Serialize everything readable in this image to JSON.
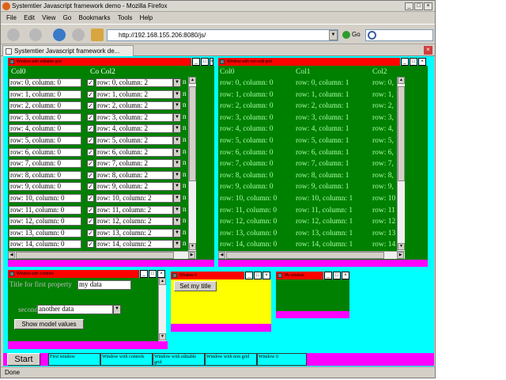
{
  "browser": {
    "title": "Systemtier Javascript framework demo - Mozilla Firefox",
    "menu": [
      "File",
      "Edit",
      "View",
      "Go",
      "Bookmarks",
      "Tools",
      "Help"
    ],
    "url": "http://192.168.155.206:8080/js/",
    "go_label": "Go",
    "tab_label": "Systemtier Javascript framework de...",
    "status": "Done"
  },
  "grid_window": {
    "title": "Window with editable grid",
    "headers": [
      "Col0",
      "Co Col2",
      ""
    ],
    "rows": [
      [
        "row: 0, column: 0",
        "row: 0, column: 2",
        "n"
      ],
      [
        "row: 1, column: 0",
        "row: 1, column: 2",
        "n"
      ],
      [
        "row: 2, column: 0",
        "row: 2, column: 2",
        "n"
      ],
      [
        "row: 3, column: 0",
        "row: 3, column: 2",
        "n"
      ],
      [
        "row: 4, column: 0",
        "row: 4, column: 2",
        "n"
      ],
      [
        "row: 5, column: 0",
        "row: 5, column: 2",
        "n"
      ],
      [
        "row: 6, column: 0",
        "row: 6, column: 2",
        "n"
      ],
      [
        "row: 7, column: 0",
        "row: 7, column: 2",
        "n"
      ],
      [
        "row: 8, column: 0",
        "row: 8, column: 2",
        "n"
      ],
      [
        "row: 9, column: 0",
        "row: 9, column: 2",
        "n"
      ],
      [
        "row: 10, column: 0",
        "row: 10, column: 2",
        "n"
      ],
      [
        "row: 11, column: 0",
        "row: 11, column: 2",
        "n"
      ],
      [
        "row: 12, column: 0",
        "row: 12, column: 2",
        "n"
      ],
      [
        "row: 13, column: 0",
        "row: 13, column: 2",
        "n"
      ],
      [
        "row: 14, column: 0",
        "row: 14, column: 2",
        "n"
      ]
    ]
  },
  "noedit_window": {
    "title": "Window with non edit grid",
    "headers": [
      "Col0",
      "Col1",
      "Col2"
    ],
    "rows": [
      [
        "row: 0, column: 0",
        "row: 0, column: 1",
        "row: 0,"
      ],
      [
        "row: 1, column: 0",
        "row: 1, column: 1",
        "row: 1,"
      ],
      [
        "row: 2, column: 0",
        "row: 2, column: 1",
        "row: 2,"
      ],
      [
        "row: 3, column: 0",
        "row: 3, column: 1",
        "row: 3,"
      ],
      [
        "row: 4, column: 0",
        "row: 4, column: 1",
        "row: 4,"
      ],
      [
        "row: 5, column: 0",
        "row: 5, column: 1",
        "row: 5,"
      ],
      [
        "row: 6, column: 0",
        "row: 6, column: 1",
        "row: 6,"
      ],
      [
        "row: 7, column: 0",
        "row: 7, column: 1",
        "row: 7,"
      ],
      [
        "row: 8, column: 0",
        "row: 8, column: 1",
        "row: 8,"
      ],
      [
        "row: 9, column: 0",
        "row: 9, column: 1",
        "row: 9,"
      ],
      [
        "row: 10, column: 0",
        "row: 10, column: 1",
        "row: 10"
      ],
      [
        "row: 11, column: 0",
        "row: 11, column: 1",
        "row: 11"
      ],
      [
        "row: 12, column: 0",
        "row: 12, column: 1",
        "row: 12"
      ],
      [
        "row: 13, column: 0",
        "row: 13, column: 1",
        "row: 13"
      ],
      [
        "row: 14, column: 0",
        "row: 14, column: 1",
        "row: 14"
      ]
    ]
  },
  "controls_window": {
    "title": "Window with controls",
    "field1_label": "Title for first property",
    "field1_value": "my data",
    "field2_label": "second",
    "field2_value": "another data",
    "button_label": "Show model values"
  },
  "window0": {
    "title": "Window 0",
    "button_label": "Set my title"
  },
  "my_window": {
    "title": "My window"
  },
  "taskbar": {
    "start_label": "Start",
    "items": [
      "First window",
      "Window with controls",
      "Window with editable grid",
      "Window with non grid",
      "Window 0"
    ]
  },
  "colors": {
    "desktop": "#00ffff",
    "title": "#ff0000",
    "panel": "#008000",
    "footer": "#ff00ff",
    "yellow": "#ffff00"
  }
}
